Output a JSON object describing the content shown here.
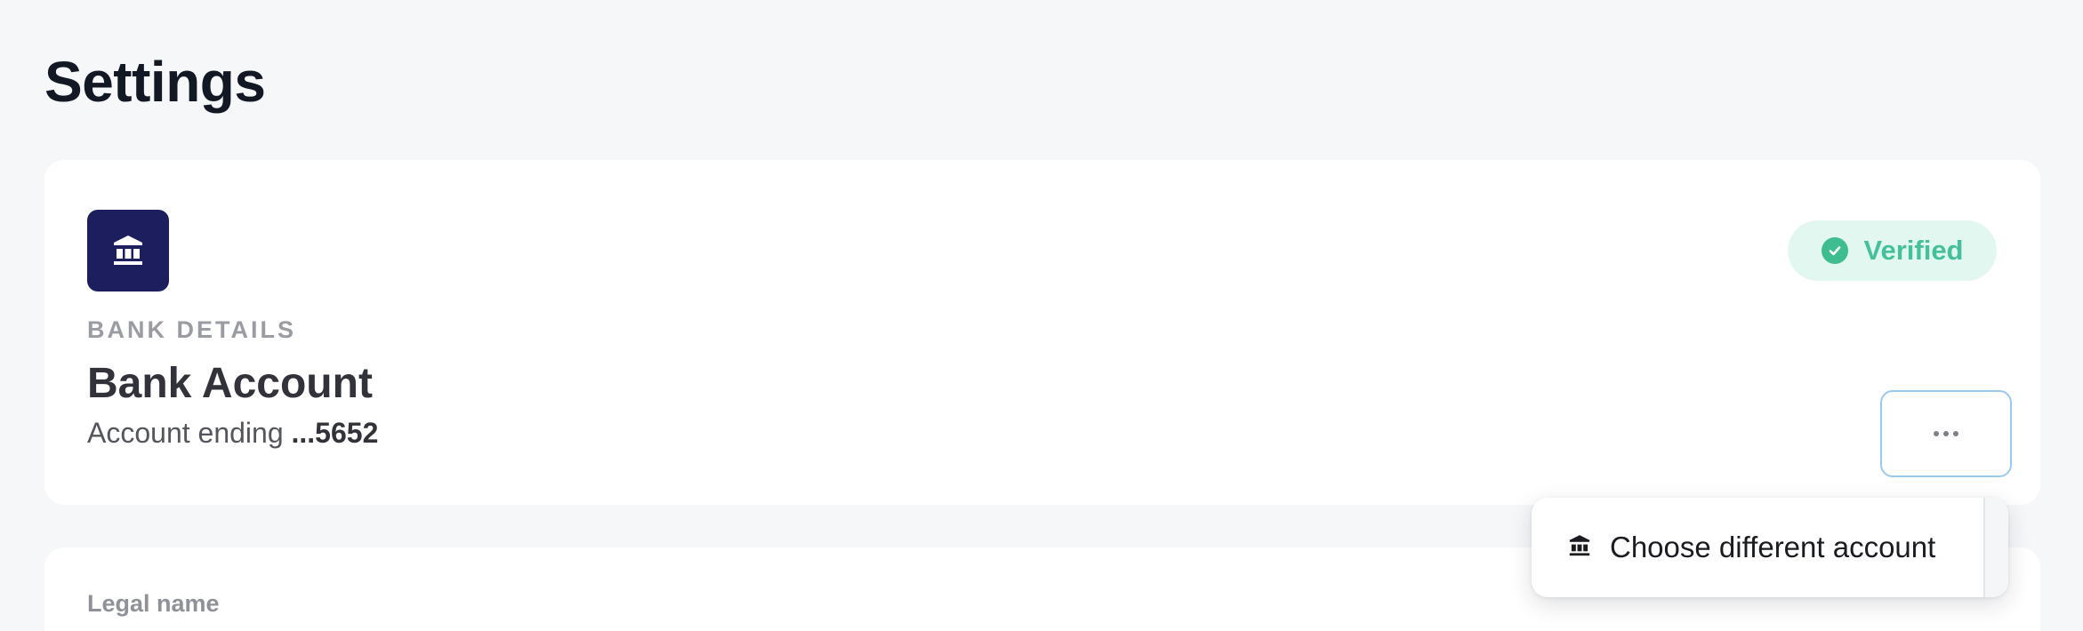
{
  "page": {
    "title": "Settings"
  },
  "bank_card": {
    "section_label": "BANK DETAILS",
    "title": "Bank Account",
    "account_prefix": "Account ending ",
    "account_last4": "...5652",
    "status_badge": "Verified",
    "bank_icon": "bank-icon",
    "more_icon": "more-horizontal-icon"
  },
  "legal_card": {
    "label": "Legal name"
  },
  "dropdown": {
    "items": [
      {
        "label": "Choose different account",
        "icon": "bank-icon"
      }
    ]
  },
  "colors": {
    "background": "#f6f7f9",
    "card": "#ffffff",
    "bank_icon_bg": "#1d1e5e",
    "verified_bg": "#e2f7ef",
    "verified_text": "#45c09a",
    "focus_border": "#9cc9f0"
  }
}
